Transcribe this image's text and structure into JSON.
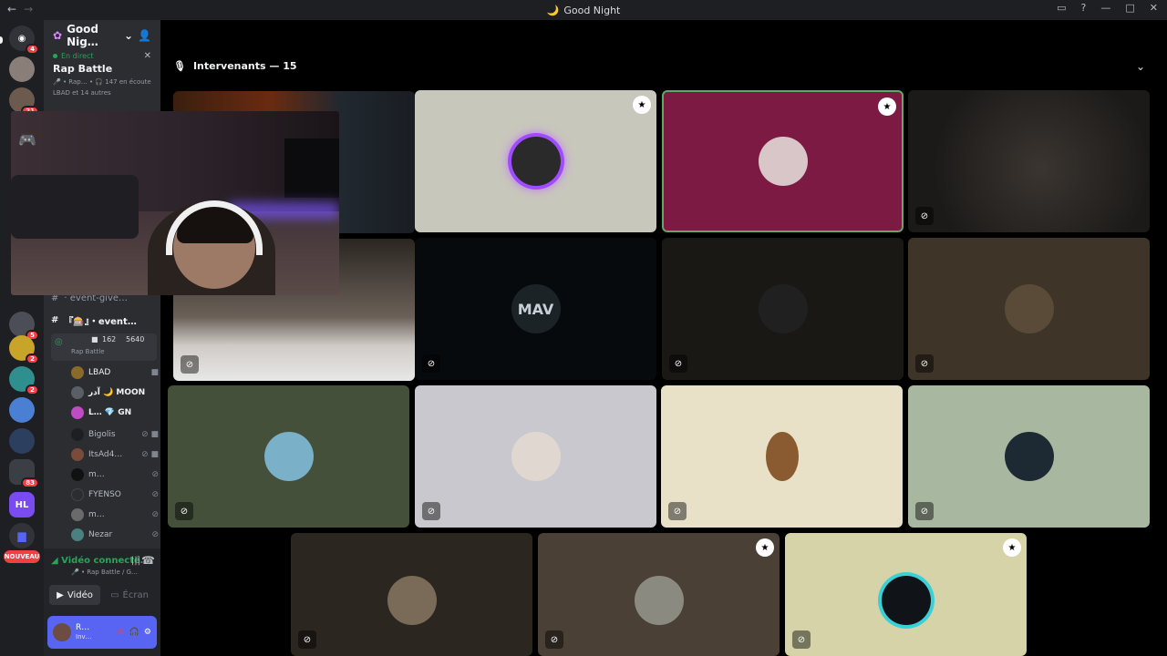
{
  "window": {
    "title": "Good Night"
  },
  "guilds": {
    "badges": [
      "4",
      "21",
      "5",
      "2",
      "2",
      "83"
    ],
    "new_label": "NOUVEAU",
    "hl": "HL"
  },
  "server": {
    "name": "Good Nig…",
    "live_label": "En direct",
    "stage_title": "Rap Battle",
    "stage_meta": "🎤 • Rap… • 🎧 147 en écoute",
    "stage_speakers": "LBAD et 14 autres"
  },
  "channels": [
    {
      "label": "· event-give…"
    },
    {
      "label": "『🎰』・event…"
    }
  ],
  "voice_channel": {
    "name": "Rap Battle",
    "cam_count": "162",
    "listener_count": "5640"
  },
  "voice_users": [
    "LBAD",
    "آدر 🌙 MOON",
    "L… 💎 GN",
    "Bigolis",
    "ItsAd4…",
    "m…",
    "FYENSO",
    "m…",
    "Nezar"
  ],
  "panel": {
    "status": "Vidéo connecté…",
    "sub": "🎤 • Rap Battle / G…",
    "video": "Vidéo",
    "screen": "Écran",
    "user": "R…",
    "user_status": "Inv…"
  },
  "stage": {
    "header": "Intervenants — 15"
  },
  "colors": {
    "accent": "#5865f2",
    "online": "#23a55a",
    "badge": "#f23f43"
  }
}
